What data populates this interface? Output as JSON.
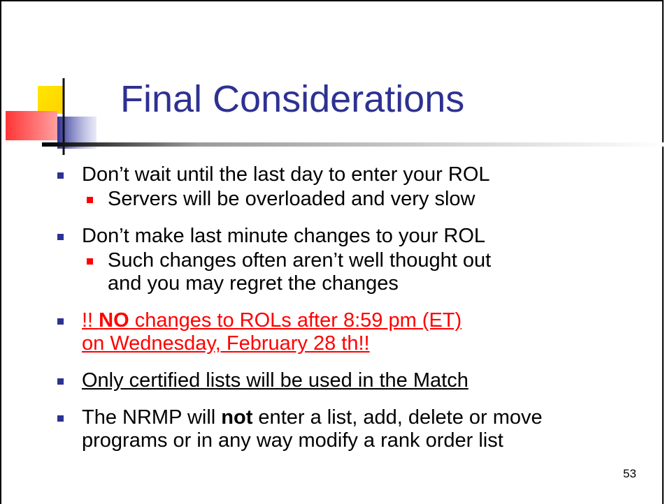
{
  "slide": {
    "title": "Final Considerations",
    "page_number": "53"
  },
  "bullets": [
    {
      "text": "Don’t wait until the last day to enter your ROL",
      "sub": [
        "Servers will be overloaded and very slow"
      ]
    },
    {
      "text": "Don’t make last minute changes to your ROL",
      "sub": [
        "Such changes often aren’t well thought out and you may regret the changes"
      ]
    },
    {
      "prefix": "!! ",
      "bold": "NO",
      "rest": " changes to ROLs after 8:59 pm (ET) on Wednesday, February 28 th!!"
    },
    {
      "text": "Only certified lists will be used in the Match"
    },
    {
      "pre": "The NRMP will ",
      "bold": "not",
      "post": " enter a list, add, delete or move programs or in any way modify a rank order list"
    }
  ],
  "colors": {
    "title": "#2e3192",
    "bullet_primary": "#2e3192",
    "bullet_secondary": "#ff0000",
    "highlight": "#ff0000"
  }
}
